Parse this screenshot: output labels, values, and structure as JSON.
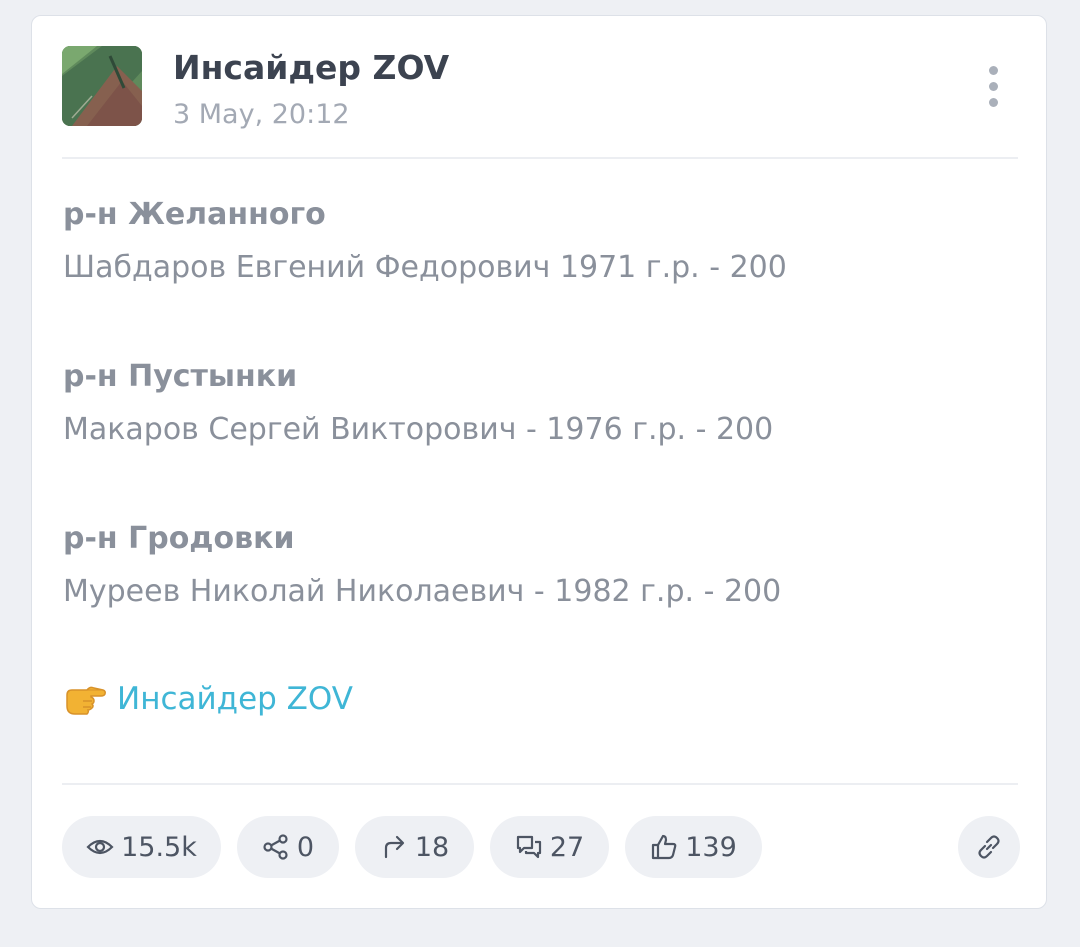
{
  "post": {
    "channel_name": "Инсайдер ZOV",
    "date": "3 May, 20:12",
    "sections": [
      {
        "title": "р-н Желанного",
        "line": "Шабдаров Евгений Федорович 1971 г.р. - 200"
      },
      {
        "title": "р-н Пустынки",
        "line": "Макаров Сергей Викторович - 1976 г.р. - 200"
      },
      {
        "title": "р-н Гродовки",
        "line": "Муреев Николай Николаевич - 1982 г.р. - 200"
      }
    ],
    "link_text": "Инсайдер ZOV",
    "link_emoji": "👉"
  },
  "stats": {
    "views": "15.5k",
    "shares": "0",
    "forwards": "18",
    "comments": "27",
    "likes": "139"
  },
  "icons": {
    "views": "eye-icon",
    "shares": "share-icon",
    "forwards": "forward-arrow-icon",
    "comments": "comments-icon",
    "likes": "thumbs-up-icon",
    "copy_link": "link-icon",
    "menu": "more-vertical-icon"
  },
  "colors": {
    "accent_link": "#3fb6d6",
    "heading_text": "#3c4350",
    "body_text": "#8a909b",
    "pill_background": "#eef0f4"
  }
}
